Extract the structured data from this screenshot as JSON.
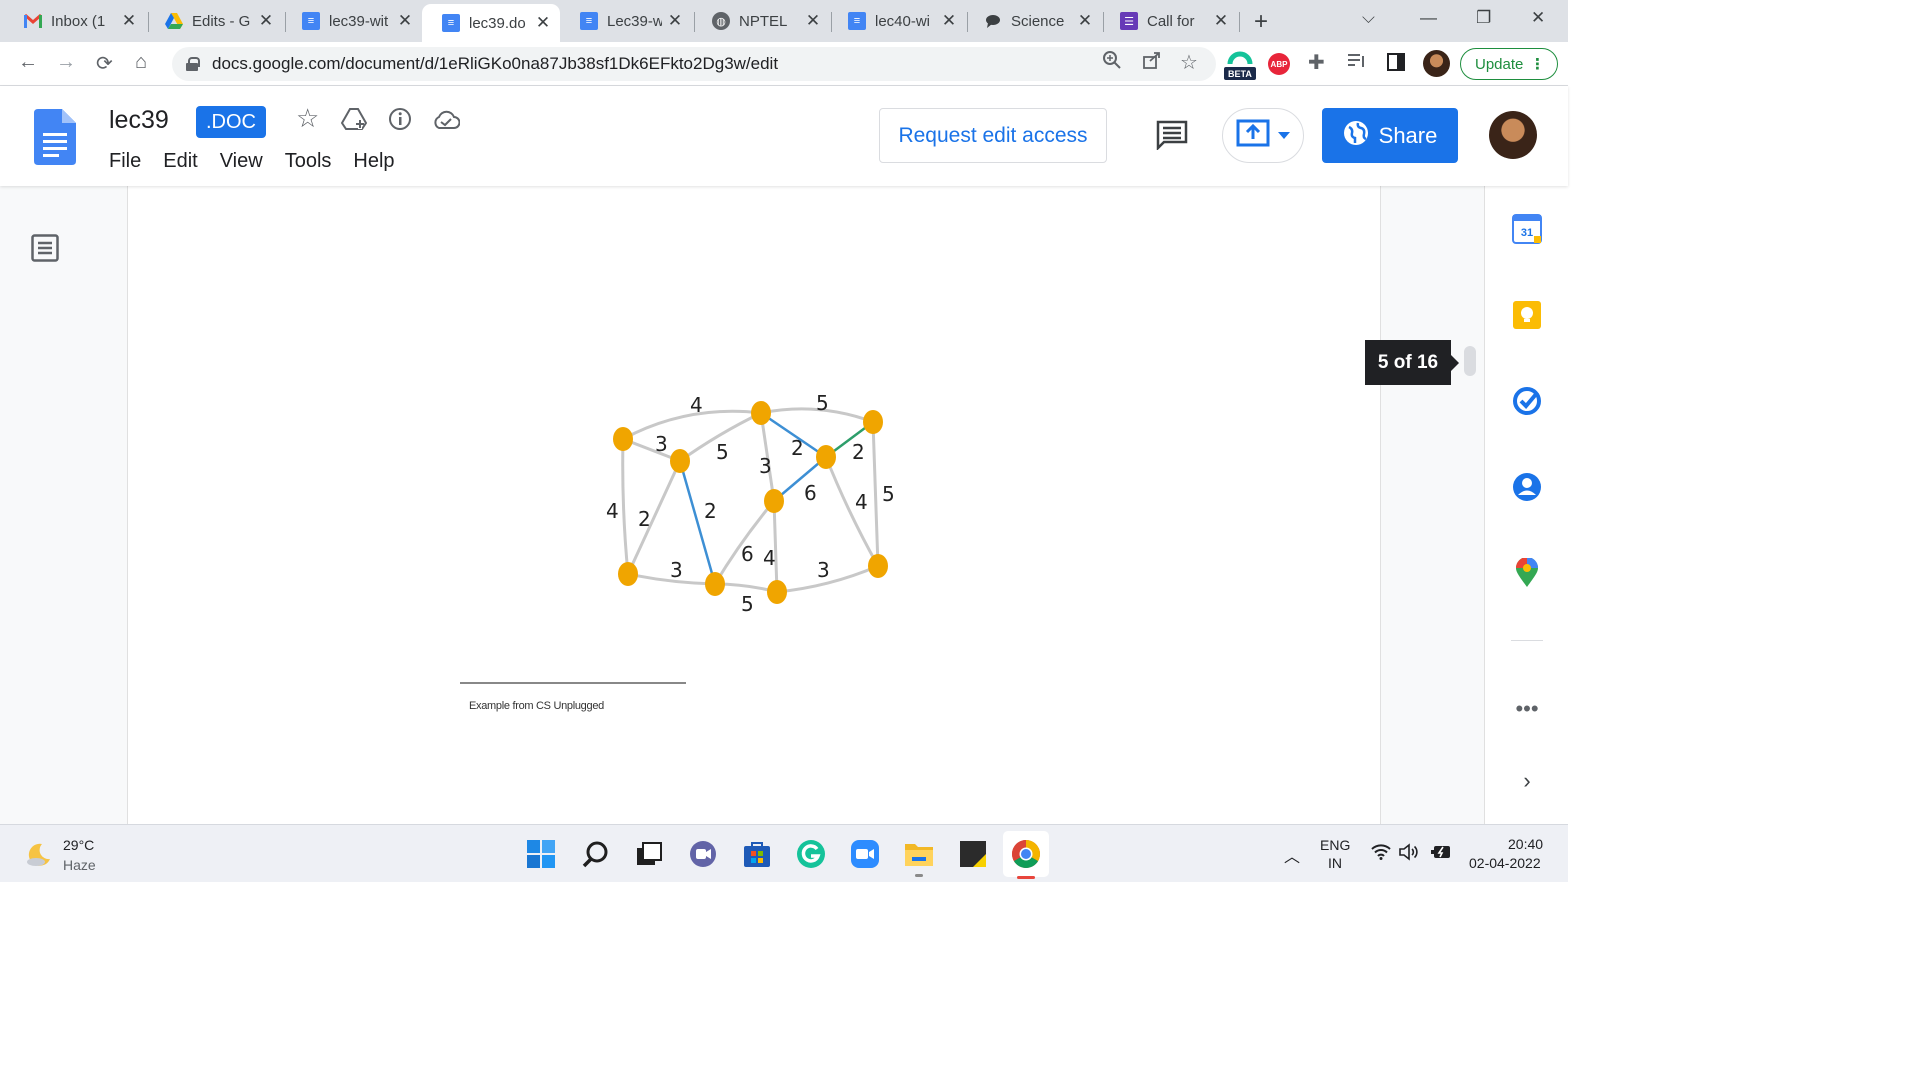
{
  "browser": {
    "tabs": [
      {
        "label": "Inbox (1",
        "favicon": "gmail-icon"
      },
      {
        "label": "Edits - G",
        "favicon": "drive-icon"
      },
      {
        "label": "lec39-wit",
        "favicon": "docs-icon"
      },
      {
        "label": "lec39.do",
        "favicon": "docs-icon",
        "active": true
      },
      {
        "label": "Lec39-w",
        "favicon": "docs-icon"
      },
      {
        "label": "NPTEL",
        "favicon": "globe-icon"
      },
      {
        "label": "lec40-wi",
        "favicon": "docs-icon"
      },
      {
        "label": "Science",
        "favicon": "chat-icon"
      },
      {
        "label": "Call for",
        "favicon": "forms-icon"
      }
    ],
    "url": "docs.google.com/document/d/1eRliGKo0na87Jb38sf1Dk6EFkto2Dg3w/edit",
    "update_label": "Update",
    "beta_label": "BETA",
    "abp_label": "ABP"
  },
  "docs": {
    "title": "lec39",
    "badge": ".DOC",
    "menu": [
      "File",
      "Edit",
      "View",
      "Tools",
      "Help"
    ],
    "request_label": "Request edit access",
    "share_label": "Share"
  },
  "page": {
    "footnote": "Example from CS Unplugged",
    "page_indicator": "5 of 16"
  },
  "graph": {
    "edge_weights": [
      "4",
      "5",
      "3",
      "5",
      "2",
      "2",
      "3",
      "6",
      "4",
      "2",
      "2",
      "5",
      "4",
      "6",
      "4",
      "3",
      "3",
      "5"
    ]
  },
  "colors": {
    "node": "#f0a500",
    "mst_blue": "#3d8fd4",
    "mst_green": "#2e9e6b",
    "edge_gray": "#c8c8c8",
    "accent": "#1a73e8"
  },
  "taskbar": {
    "weather_temp": "29°C",
    "weather_desc": "Haze",
    "lang_line1": "ENG",
    "lang_line2": "IN",
    "time": "20:40",
    "date": "02-04-2022"
  }
}
